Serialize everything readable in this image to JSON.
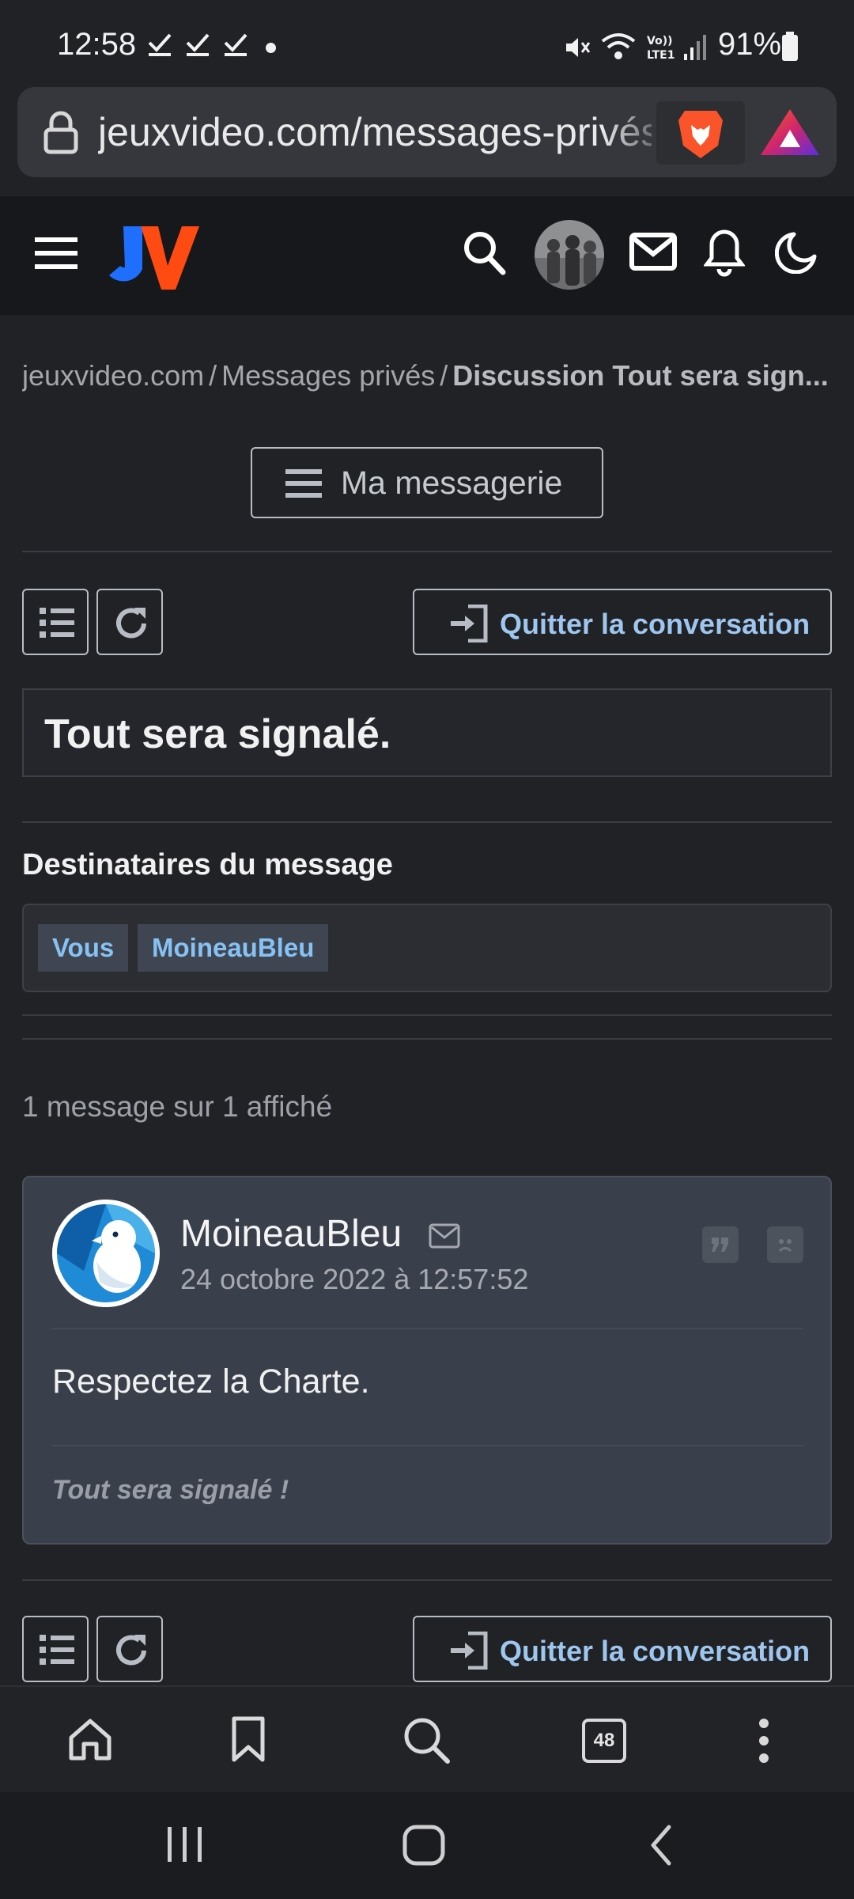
{
  "status_bar": {
    "time": "12:58",
    "battery": "91%"
  },
  "browser": {
    "url": "jeuxvideo.com/messages-privés",
    "tab_count": "48"
  },
  "breadcrumb": {
    "site": "jeuxvideo.com",
    "section": "Messages privés",
    "current": "Discussion Tout sera sign..."
  },
  "messagerie_button": "Ma messagerie",
  "quit_label": "Quitter la conversation",
  "conversation_title": "Tout sera signalé.",
  "recipients": {
    "heading": "Destinataires du message",
    "list": [
      "Vous",
      "MoineauBleu"
    ]
  },
  "message_count": "1 message sur 1 affiché",
  "message": {
    "author": "MoineauBleu",
    "date": "24 octobre 2022 à 12:57:52",
    "body": "Respectez la Charte.",
    "signature": "Tout sera signalé !"
  },
  "colors": {
    "accent_blue": "#9ec6ee",
    "chip_text": "#86c2f4",
    "logo_orange": "#ff4a12",
    "logo_blue": "#1f6fff"
  },
  "icons": {
    "status": [
      "check-icon",
      "mute-icon",
      "wifi-icon",
      "volte-icon",
      "signal-icon",
      "battery-icon"
    ],
    "browser": [
      "lock-icon",
      "brave-lion-icon",
      "brave-rewards-icon"
    ],
    "header": [
      "hamburger-icon",
      "search-icon",
      "user-avatar",
      "mail-icon",
      "bell-icon",
      "moon-icon"
    ],
    "toolbar": [
      "home-icon",
      "bookmark-icon",
      "search-icon",
      "tabs-icon",
      "more-icon"
    ],
    "nav": [
      "recents-icon",
      "home-nav-icon",
      "back-icon"
    ]
  }
}
